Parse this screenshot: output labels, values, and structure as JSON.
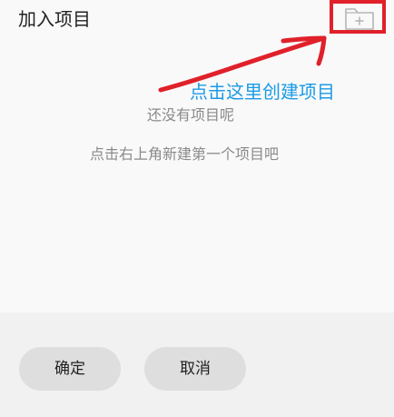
{
  "dialog": {
    "title": "加入项目",
    "empty_title": "还没有项目呢",
    "empty_hint": "点击右上角新建第一个项目吧",
    "confirm_label": "确定",
    "cancel_label": "取消"
  },
  "annotation": {
    "text": "点击这里创建项目",
    "text_color": "#1b9be5",
    "highlight_color": "#e0212a"
  },
  "icons": {
    "new_folder": "folder-plus-icon"
  }
}
